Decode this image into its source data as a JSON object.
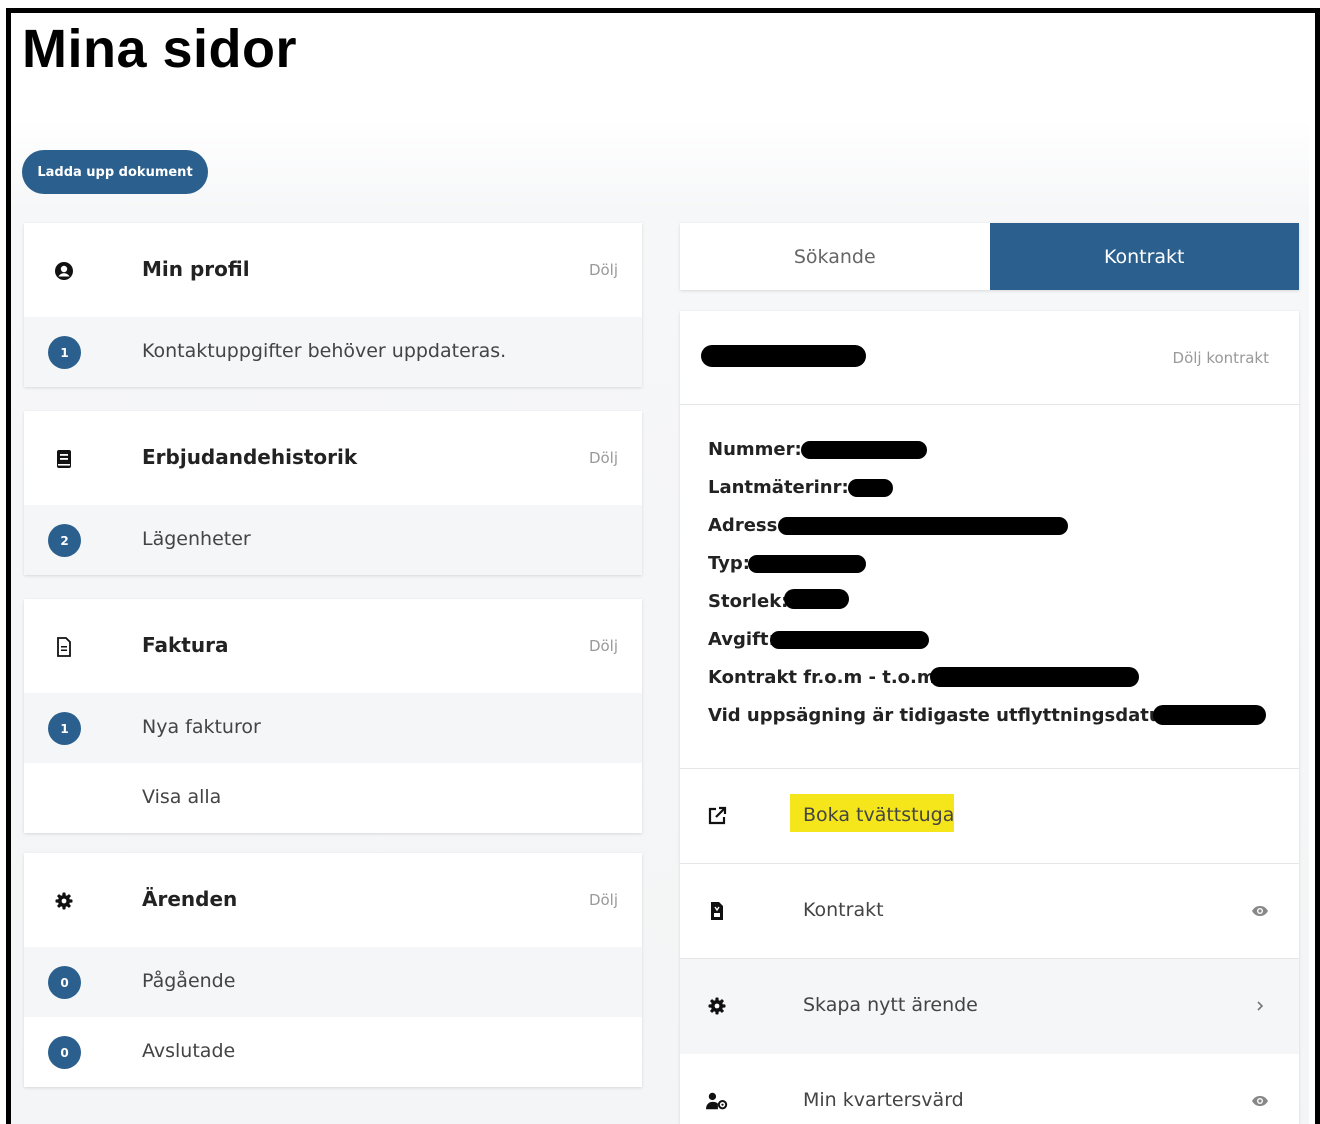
{
  "page": {
    "title": "Mina sidor"
  },
  "upload_button": {
    "label": "Ladda upp dokument"
  },
  "cards": [
    {
      "title": "Min profil",
      "hide_label": "Dölj",
      "icon": "user-circle-icon",
      "rows": [
        {
          "badge": "1",
          "label": "Kontaktuppgifter behöver uppdateras."
        }
      ]
    },
    {
      "title": "Erbjudandehistorik",
      "hide_label": "Dölj",
      "icon": "book-icon",
      "rows": [
        {
          "badge": "2",
          "label": "Lägenheter"
        }
      ]
    },
    {
      "title": "Faktura",
      "hide_label": "Dölj",
      "icon": "file-icon",
      "rows": [
        {
          "badge": "1",
          "label": "Nya fakturor"
        },
        {
          "badge": "",
          "label": "Visa alla"
        }
      ]
    },
    {
      "title": "Ärenden",
      "hide_label": "Dölj",
      "icon": "gear-icon",
      "rows": [
        {
          "badge": "0",
          "label": "Pågående"
        },
        {
          "badge": "0",
          "label": "Avslutade"
        }
      ]
    }
  ],
  "tabs": [
    {
      "label": "Sökande",
      "active": false
    },
    {
      "label": "Kontrakt",
      "active": true
    }
  ],
  "contract": {
    "hide_label": "Dölj kontrakt",
    "fields": [
      "Nummer:",
      "Lantmäterinr: ",
      "Adress:",
      "Typ:",
      "Storlek:",
      "Avgift:",
      "Kontrakt fr.o.m - t.o.m: ",
      "Vid uppsägning är tidigaste utflyttningsdatum:"
    ],
    "links": [
      {
        "label": "Boka tvättstuga",
        "icon": "external-link-icon",
        "end_icon": ""
      },
      {
        "label": "Kontrakt",
        "icon": "document-icon",
        "end_icon": "eye-icon"
      },
      {
        "label": "Skapa nytt ärende",
        "icon": "gear-icon",
        "end_icon": "chevron-right-icon"
      },
      {
        "label": "Min kvartersvärd",
        "icon": "user-gear-icon",
        "end_icon": "eye-icon"
      }
    ]
  },
  "colors": {
    "primary": "#2b5f8d",
    "highlight": "#f5e61c",
    "row_shade": "#f4f6f7"
  }
}
